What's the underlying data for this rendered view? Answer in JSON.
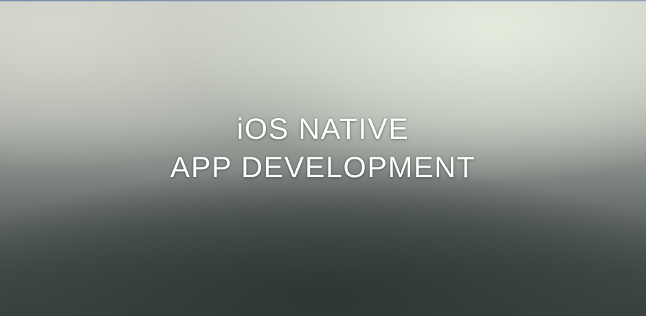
{
  "headline": {
    "line1": "iOS NATIVE",
    "line2": "APP DEVELOPMENT"
  }
}
